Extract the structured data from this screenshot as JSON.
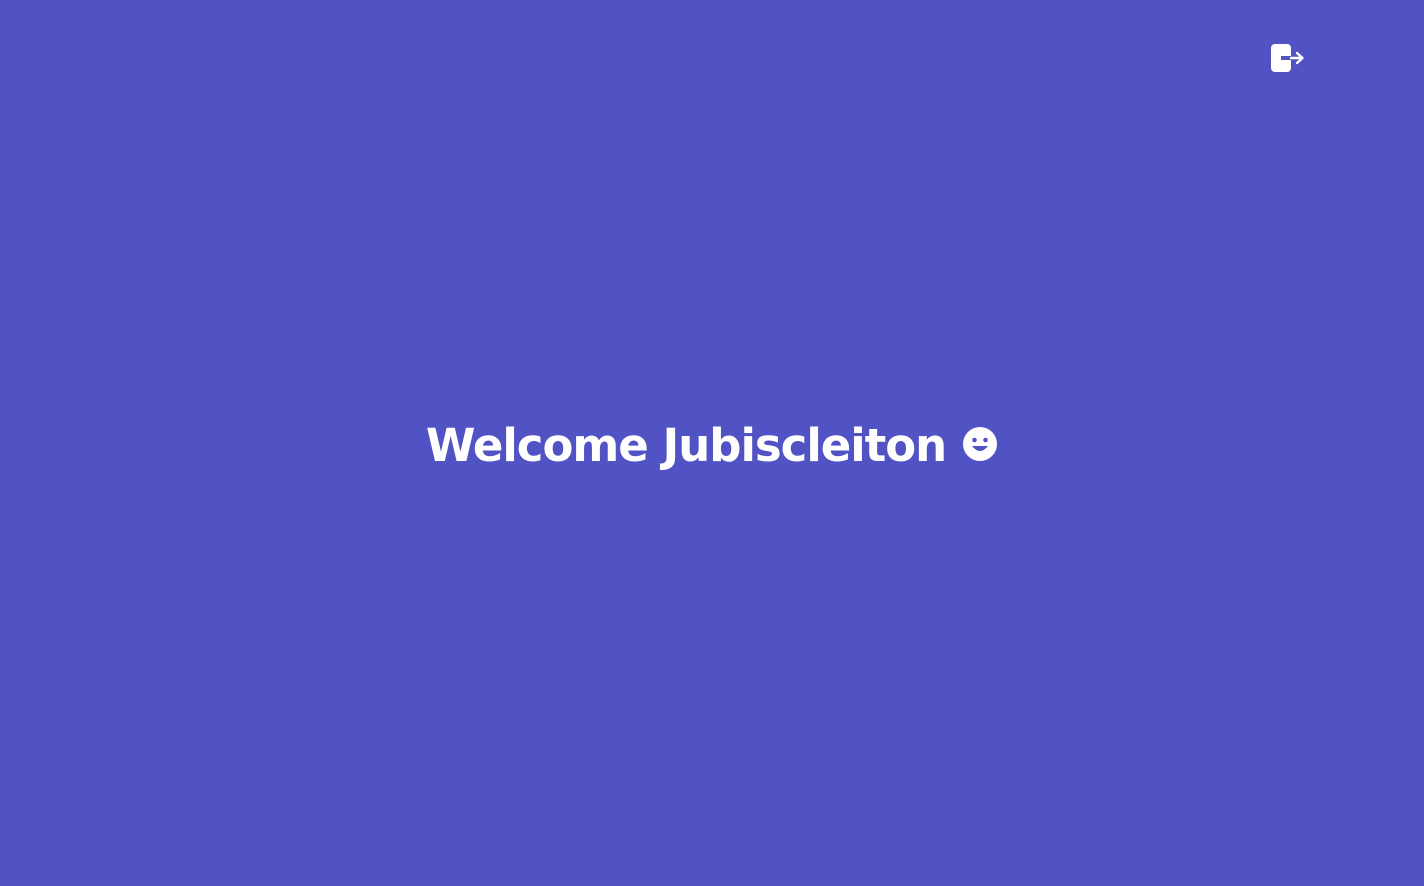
{
  "header": {
    "logout_icon": "logout-icon"
  },
  "main": {
    "welcome_text": "Welcome Jubiscleiton",
    "emoji_icon": "smiling-face-icon"
  },
  "colors": {
    "background": "#5153C4",
    "foreground": "#FFFFFF"
  }
}
